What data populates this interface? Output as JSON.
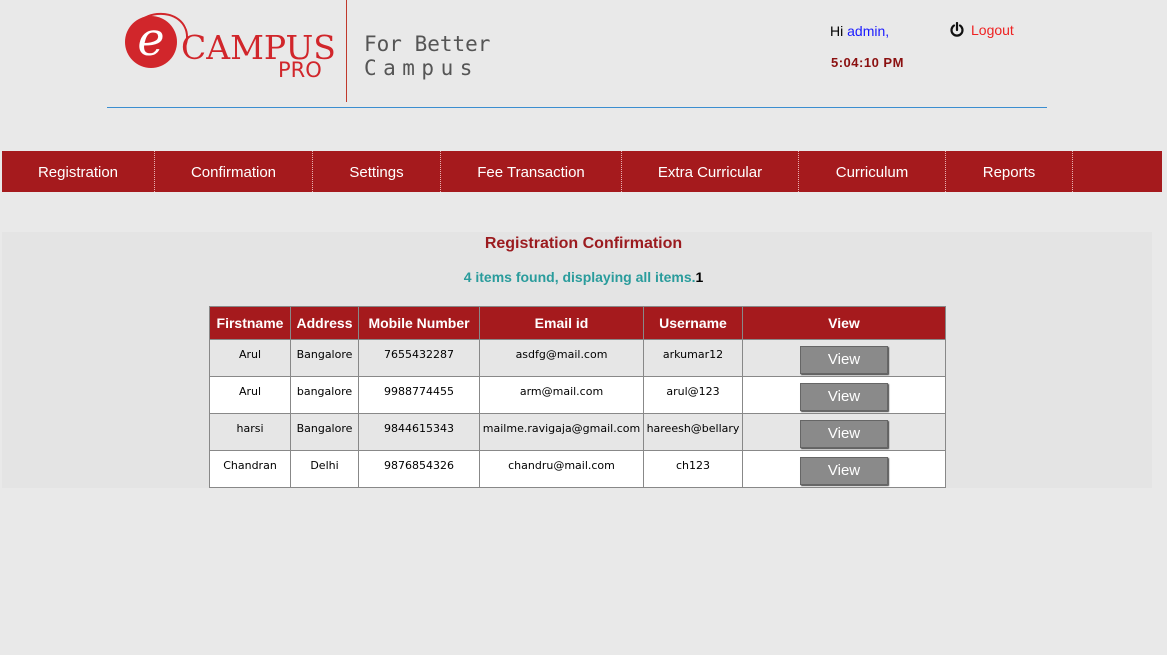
{
  "header": {
    "logo_text": "CAMPUS",
    "logo_e": "e",
    "logo_pro": "PRO",
    "tagline_line1": "For Better",
    "tagline_line2": "Campus",
    "greeting": "Hi",
    "username": "admin",
    "greeting_suffix": ",",
    "logout_label": "Logout",
    "time": "5:04:10 PM"
  },
  "nav": {
    "items": [
      {
        "label": "Registration"
      },
      {
        "label": "Confirmation"
      },
      {
        "label": "Settings"
      },
      {
        "label": "Fee Transaction"
      },
      {
        "label": "Extra Curricular"
      },
      {
        "label": "Curriculum"
      },
      {
        "label": "Reports"
      }
    ]
  },
  "main": {
    "title": "Registration Confirmation",
    "items_found": "4 items found, displaying all items.",
    "page_number": "1",
    "columns": [
      "Firstname",
      "Address",
      "Mobile Number",
      "Email id",
      "Username",
      "View"
    ],
    "rows": [
      {
        "firstname": "Arul",
        "address": "Bangalore",
        "mobile": "7655432287",
        "email": "asdfg@mail.com",
        "username": "arkumar12",
        "action": "View"
      },
      {
        "firstname": "Arul",
        "address": "bangalore",
        "mobile": "9988774455",
        "email": "arm@mail.com",
        "username": "arul@123",
        "action": "View"
      },
      {
        "firstname": "harsi",
        "address": "Bangalore",
        "mobile": "9844615343",
        "email": "mailme.ravigaja@gmail.com",
        "username": "hareesh@bellary",
        "action": "View"
      },
      {
        "firstname": "Chandran",
        "address": "Delhi",
        "mobile": "9876854326",
        "email": "chandru@mail.com",
        "username": "ch123",
        "action": "View"
      }
    ]
  },
  "colors": {
    "brand_red": "#a51a1d",
    "logo_red": "#d1262b",
    "accent_teal": "#2a9c9c",
    "link_blue": "#1a1aff"
  },
  "icons": {
    "logout": "power-icon"
  }
}
